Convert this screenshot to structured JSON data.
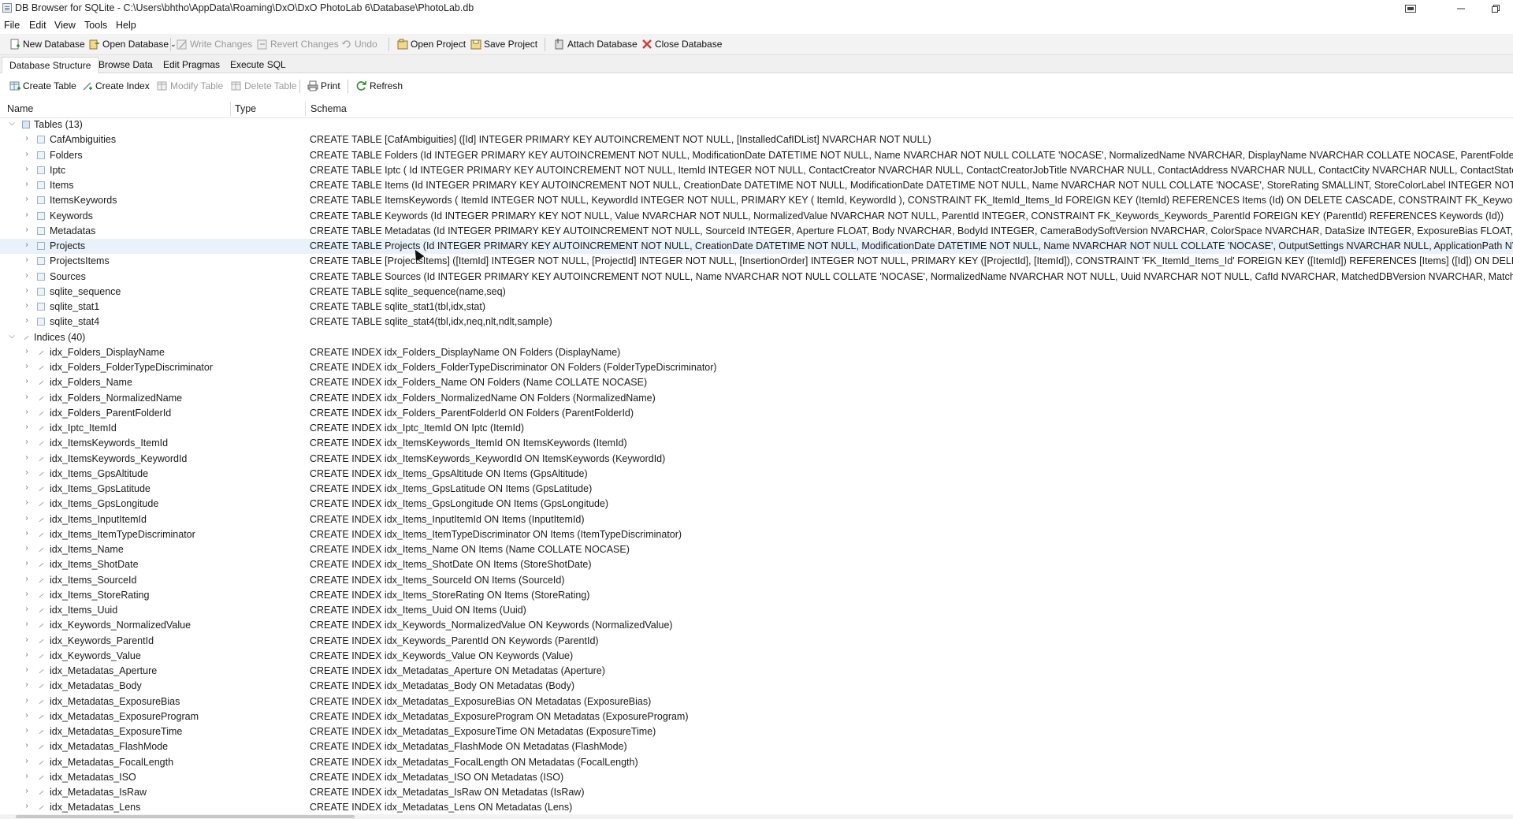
{
  "window": {
    "title": "DB Browser for SQLite - C:\\Users\\bhtho\\AppData\\Roaming\\DxO\\DxO PhotoLab 6\\Database\\PhotoLab.db"
  },
  "menu": [
    "File",
    "Edit",
    "View",
    "Tools",
    "Help"
  ],
  "toolbar": {
    "new_database": "New Database",
    "open_database": "Open Database",
    "write_changes": "Write Changes",
    "revert_changes": "Revert Changes",
    "undo": "Undo",
    "open_project": "Open Project",
    "save_project": "Save Project",
    "attach_database": "Attach Database",
    "close_database": "Close Database"
  },
  "tabs": [
    "Database Structure",
    "Browse Data",
    "Edit Pragmas",
    "Execute SQL"
  ],
  "structure_toolbar": {
    "create_table": "Create Table",
    "create_index": "Create Index",
    "modify_table": "Modify Table",
    "delete_table": "Delete Table",
    "print": "Print",
    "refresh": "Refresh"
  },
  "columns": {
    "name": "Name",
    "type": "Type",
    "schema": "Schema"
  },
  "tables_group": "Tables (13)",
  "tables": [
    {
      "name": "CafAmbiguities",
      "schema": "CREATE TABLE [CafAmbiguities] ([Id] INTEGER PRIMARY KEY AUTOINCREMENT NOT NULL, [InstalledCafIDList] NVARCHAR NOT NULL)"
    },
    {
      "name": "Folders",
      "schema": "CREATE TABLE Folders (Id INTEGER PRIMARY KEY AUTOINCREMENT NOT NULL, ModificationDate DATETIME NOT NULL, Name NVARCHAR NOT NULL COLLATE 'NOCASE', NormalizedName NVARCHAR, DisplayName NVARCHAR COLLATE NOCASE, ParentFolderId INTEGER, M"
    },
    {
      "name": "Iptc",
      "schema": "CREATE TABLE Iptc ( Id INTEGER PRIMARY KEY AUTOINCREMENT NOT NULL, ItemId INTEGER NOT NULL, ContactCreator NVARCHAR NULL, ContactCreatorJobTitle NVARCHAR NULL, ContactAddress NVARCHAR NULL, ContactCity NVARCHAR NULL, ContactState NVARCHAR"
    },
    {
      "name": "Items",
      "schema": "CREATE TABLE Items (Id INTEGER PRIMARY KEY AUTOINCREMENT NOT NULL, CreationDate DATETIME NOT NULL, ModificationDate DATETIME NOT NULL, Name NVARCHAR NOT NULL COLLATE 'NOCASE', StoreRating SMALLINT, StoreColorLabel INTEGER NOT NULL, StoreL"
    },
    {
      "name": "ItemsKeywords",
      "schema": "CREATE TABLE ItemsKeywords ( ItemId INTEGER NOT NULL, KeywordId INTEGER NOT NULL, PRIMARY KEY ( ItemId, KeywordId ), CONSTRAINT FK_ItemId_Items_Id FOREIGN KEY (ItemId) REFERENCES Items (Id) ON DELETE CASCADE, CONSTRAINT FK_KeywordId_Keyw"
    },
    {
      "name": "Keywords",
      "schema": "CREATE TABLE Keywords (Id INTEGER PRIMARY KEY NOT NULL, Value NVARCHAR NOT NULL, NormalizedValue NVARCHAR NOT NULL, ParentId INTEGER, CONSTRAINT FK_Keywords_Keywords_ParentId FOREIGN KEY (ParentId) REFERENCES Keywords (Id))"
    },
    {
      "name": "Metadatas",
      "schema": "CREATE TABLE Metadatas (Id INTEGER PRIMARY KEY AUTOINCREMENT NOT NULL, SourceId INTEGER, Aperture FLOAT, Body NVARCHAR, BodyId INTEGER, CameraBodySoftVersion NVARCHAR, ColorSpace NVARCHAR, DataSize INTEGER, ExposureBias FLOAT, ExposureTime"
    },
    {
      "name": "Projects",
      "schema": "CREATE TABLE Projects (Id INTEGER PRIMARY KEY AUTOINCREMENT NOT NULL, CreationDate DATETIME NOT NULL, ModificationDate DATETIME NOT NULL, Name NVARCHAR NOT NULL COLLATE 'NOCASE', OutputSettings NVARCHAR NULL, ApplicationPath NVARCHAR"
    },
    {
      "name": "ProjectsItems",
      "schema": "CREATE TABLE [ProjectsItems] ([ItemId] INTEGER NOT NULL, [ProjectId] INTEGER NOT NULL, [InsertionOrder] INTEGER NOT NULL, PRIMARY KEY ([ProjectId], [ItemId]), CONSTRAINT 'FK_ItemId_Items_Id' FOREIGN KEY ([ItemId]) REFERENCES [Items] ([Id]) ON DELETE"
    },
    {
      "name": "Sources",
      "schema": "CREATE TABLE Sources (Id INTEGER PRIMARY KEY AUTOINCREMENT NOT NULL, Name NVARCHAR NOT NULL COLLATE 'NOCASE', NormalizedName NVARCHAR NOT NULL, Uuid NVARCHAR NOT NULL, CafId NVARCHAR, MatchedDBVersion NVARCHAR, MatchingCafIdList NVA"
    },
    {
      "name": "sqlite_sequence",
      "schema": "CREATE TABLE sqlite_sequence(name,seq)"
    },
    {
      "name": "sqlite_stat1",
      "schema": "CREATE TABLE sqlite_stat1(tbl,idx,stat)"
    },
    {
      "name": "sqlite_stat4",
      "schema": "CREATE TABLE sqlite_stat4(tbl,idx,neq,nlt,ndlt,sample)"
    }
  ],
  "indices_group": "Indices (40)",
  "indices": [
    {
      "name": "idx_Folders_DisplayName",
      "schema": "CREATE INDEX idx_Folders_DisplayName ON Folders (DisplayName)"
    },
    {
      "name": "idx_Folders_FolderTypeDiscriminator",
      "schema": "CREATE INDEX idx_Folders_FolderTypeDiscriminator ON Folders (FolderTypeDiscriminator)"
    },
    {
      "name": "idx_Folders_Name",
      "schema": "CREATE INDEX idx_Folders_Name ON Folders (Name COLLATE NOCASE)"
    },
    {
      "name": "idx_Folders_NormalizedName",
      "schema": "CREATE INDEX idx_Folders_NormalizedName ON Folders (NormalizedName)"
    },
    {
      "name": "idx_Folders_ParentFolderId",
      "schema": "CREATE INDEX idx_Folders_ParentFolderId ON Folders (ParentFolderId)"
    },
    {
      "name": "idx_Iptc_ItemId",
      "schema": "CREATE INDEX idx_Iptc_ItemId ON Iptc (ItemId)"
    },
    {
      "name": "idx_ItemsKeywords_ItemId",
      "schema": "CREATE INDEX idx_ItemsKeywords_ItemId ON ItemsKeywords (ItemId)"
    },
    {
      "name": "idx_ItemsKeywords_KeywordId",
      "schema": "CREATE INDEX idx_ItemsKeywords_KeywordId ON ItemsKeywords (KeywordId)"
    },
    {
      "name": "idx_Items_GpsAltitude",
      "schema": "CREATE INDEX idx_Items_GpsAltitude ON Items (GpsAltitude)"
    },
    {
      "name": "idx_Items_GpsLatitude",
      "schema": "CREATE INDEX idx_Items_GpsLatitude ON Items (GpsLatitude)"
    },
    {
      "name": "idx_Items_GpsLongitude",
      "schema": "CREATE INDEX idx_Items_GpsLongitude ON Items (GpsLongitude)"
    },
    {
      "name": "idx_Items_InputItemId",
      "schema": "CREATE INDEX idx_Items_InputItemId ON Items (InputItemId)"
    },
    {
      "name": "idx_Items_ItemTypeDiscriminator",
      "schema": "CREATE INDEX idx_Items_ItemTypeDiscriminator ON Items (ItemTypeDiscriminator)"
    },
    {
      "name": "idx_Items_Name",
      "schema": "CREATE INDEX idx_Items_Name ON Items (Name COLLATE NOCASE)"
    },
    {
      "name": "idx_Items_ShotDate",
      "schema": "CREATE INDEX idx_Items_ShotDate ON Items (StoreShotDate)"
    },
    {
      "name": "idx_Items_SourceId",
      "schema": "CREATE INDEX idx_Items_SourceId ON Items (SourceId)"
    },
    {
      "name": "idx_Items_StoreRating",
      "schema": "CREATE INDEX idx_Items_StoreRating ON Items (StoreRating)"
    },
    {
      "name": "idx_Items_Uuid",
      "schema": "CREATE INDEX idx_Items_Uuid ON Items (Uuid)"
    },
    {
      "name": "idx_Keywords_NormalizedValue",
      "schema": "CREATE INDEX idx_Keywords_NormalizedValue ON Keywords (NormalizedValue)"
    },
    {
      "name": "idx_Keywords_ParentId",
      "schema": "CREATE INDEX idx_Keywords_ParentId ON Keywords (ParentId)"
    },
    {
      "name": "idx_Keywords_Value",
      "schema": "CREATE INDEX idx_Keywords_Value ON Keywords (Value)"
    },
    {
      "name": "idx_Metadatas_Aperture",
      "schema": "CREATE INDEX idx_Metadatas_Aperture ON Metadatas (Aperture)"
    },
    {
      "name": "idx_Metadatas_Body",
      "schema": "CREATE INDEX idx_Metadatas_Body ON Metadatas (Body)"
    },
    {
      "name": "idx_Metadatas_ExposureBias",
      "schema": "CREATE INDEX idx_Metadatas_ExposureBias ON Metadatas (ExposureBias)"
    },
    {
      "name": "idx_Metadatas_ExposureProgram",
      "schema": "CREATE INDEX idx_Metadatas_ExposureProgram ON Metadatas (ExposureProgram)"
    },
    {
      "name": "idx_Metadatas_ExposureTime",
      "schema": "CREATE INDEX idx_Metadatas_ExposureTime ON Metadatas (ExposureTime)"
    },
    {
      "name": "idx_Metadatas_FlashMode",
      "schema": "CREATE INDEX idx_Metadatas_FlashMode ON Metadatas (FlashMode)"
    },
    {
      "name": "idx_Metadatas_FocalLength",
      "schema": "CREATE INDEX idx_Metadatas_FocalLength ON Metadatas (FocalLength)"
    },
    {
      "name": "idx_Metadatas_ISO",
      "schema": "CREATE INDEX idx_Metadatas_ISO ON Metadatas (ISO)"
    },
    {
      "name": "idx_Metadatas_IsRaw",
      "schema": "CREATE INDEX idx_Metadatas_IsRaw ON Metadatas (IsRaw)"
    },
    {
      "name": "idx_Metadatas_Lens",
      "schema": "CREATE INDEX idx_Metadatas_Lens ON Metadatas (Lens)"
    }
  ],
  "colors": {
    "row_highlight": "#e9f2fb",
    "close_red": "#d23a3a"
  }
}
